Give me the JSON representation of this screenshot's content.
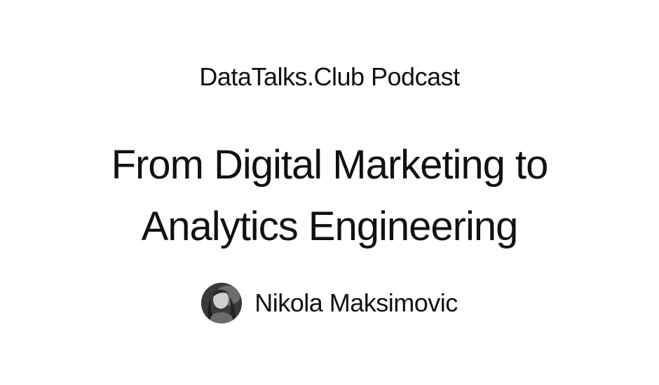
{
  "podcast": {
    "name": "DataTalks.Club Podcast"
  },
  "episode": {
    "title_lines": [
      "From Digital Marketing to",
      "Analytics Engineering"
    ]
  },
  "guest": {
    "name": "Nikola Maksimovic",
    "avatar_icon": "guest-photo"
  }
}
